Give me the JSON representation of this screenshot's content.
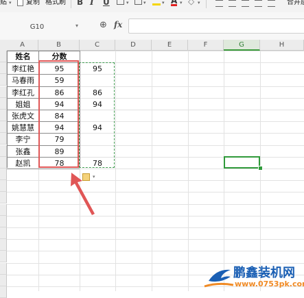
{
  "toolbar": {
    "paste_label": "贴",
    "copy_label": "复制",
    "format_painter_label": "格式刷",
    "merge_label": "合并居",
    "bold_icon": "bold-icon",
    "italic_icon": "italic-icon",
    "underline_icon": "underline-icon"
  },
  "formula_bar": {
    "name_box": "G10",
    "fx_label": "fx",
    "formula": ""
  },
  "sheet": {
    "columns": [
      "A",
      "B",
      "C",
      "D",
      "E",
      "F",
      "G",
      "H"
    ],
    "selected_column": "G",
    "table": {
      "header": [
        "姓名",
        "分数"
      ],
      "rows": [
        {
          "name": "李红艳",
          "score": "95",
          "c": "95"
        },
        {
          "name": "马春雨",
          "score": "59",
          "c": ""
        },
        {
          "name": "李红孔",
          "score": "86",
          "c": "86"
        },
        {
          "name": "姐姐",
          "score": "94",
          "c": "94"
        },
        {
          "name": "张虎文",
          "score": "84",
          "c": ""
        },
        {
          "name": "姚慧慧",
          "score": "94",
          "c": "94"
        },
        {
          "name": "李宁",
          "score": "79",
          "c": ""
        },
        {
          "name": "张鑫",
          "score": "89",
          "c": ""
        },
        {
          "name": "赵凯",
          "score": "78",
          "c": "78"
        }
      ]
    }
  },
  "annotation": {
    "highlight_color": "#e05656",
    "arrow_color": "#e05656",
    "copy_border_color": "#3e9a4e",
    "selection_color": "#2f9a3a"
  },
  "watermark": {
    "title": "鹏鑫装机网",
    "url": "www.0753pk.com"
  }
}
